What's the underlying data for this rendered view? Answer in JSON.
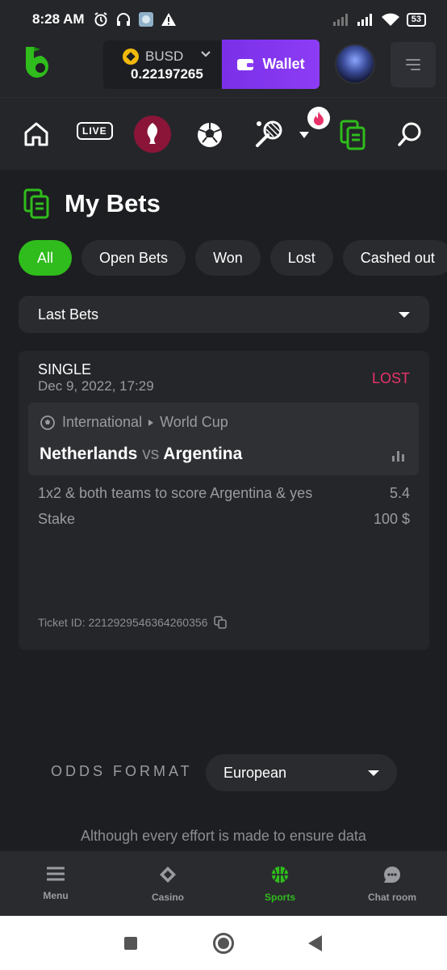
{
  "status_bar": {
    "time": "8:28 AM",
    "battery": "53"
  },
  "header": {
    "currency": "BUSD",
    "balance": "0.22197265",
    "wallet_label": "Wallet"
  },
  "nav": {
    "live_label": "LIVE"
  },
  "page": {
    "title": "My Bets"
  },
  "filters": [
    "All",
    "Open Bets",
    "Won",
    "Lost",
    "Cashed out"
  ],
  "filter_active": "All",
  "dropdown": {
    "selected": "Last Bets"
  },
  "bet": {
    "type": "SINGLE",
    "date": "Dec 9, 2022, 17:29",
    "status": "LOST",
    "category": "International",
    "league": "World Cup",
    "home": "Netherlands",
    "vs": "vs",
    "away": "Argentina",
    "market": "1x2 & both teams to score Argentina & yes",
    "odds": "5.4",
    "stake_label": "Stake",
    "stake": "100 $",
    "ticket": "Ticket ID: 2212929546364260356"
  },
  "odds_format": {
    "label": "ODDS FORMAT",
    "selected": "European"
  },
  "disclaimer": "Although every effort is made to ensure data",
  "bottom_nav": [
    {
      "label": "Menu",
      "icon": "menu-icon"
    },
    {
      "label": "Casino",
      "icon": "casino-icon"
    },
    {
      "label": "Sports",
      "icon": "basketball-icon"
    },
    {
      "label": "Chat room",
      "icon": "chat-icon"
    }
  ],
  "colors": {
    "accent_green": "#2fbc1c",
    "wallet_purple": "#7a30e8",
    "lost_pink": "#e8326a",
    "bg": "#1d1e21"
  }
}
